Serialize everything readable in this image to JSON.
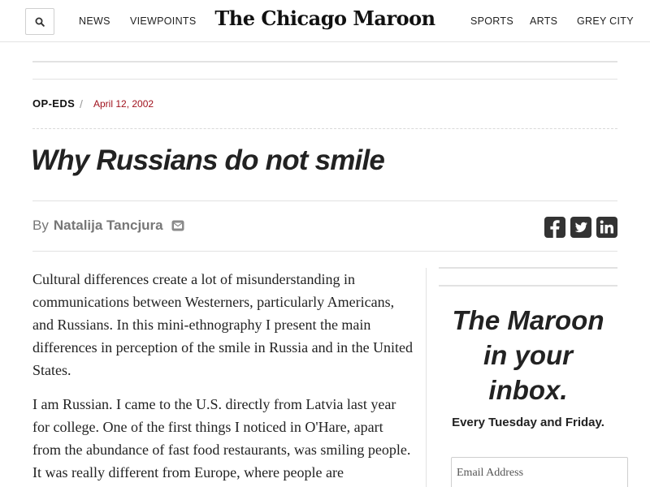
{
  "header": {
    "search_icon": "search-icon",
    "nav_left": [
      "NEWS",
      "VIEWPOINTS"
    ],
    "masthead": "The Chicago Maroon",
    "nav_right": [
      "SPORTS",
      "ARTS",
      "GREY CITY"
    ]
  },
  "article": {
    "section": "OP-EDS",
    "separator": "/",
    "date": "April 12, 2002",
    "headline": "Why Russians do not smile",
    "byline_prefix": "By",
    "author": "Natalija Tancjura",
    "paragraphs": [
      "Cultural differences create a lot of misunderstanding in communications between Westerners, particularly Americans, and Russians. In this mini-ethnography I present the main differences in perception of the smile in Russia and in the United States.",
      "I am Russian. I came to the U.S. directly from Latvia last year for college. One of the first things I noticed in O'Hare, apart from the abundance of fast food restaurants, was smiling people. It was really different from Europe, where people are"
    ]
  },
  "share": {
    "icons": [
      "facebook-icon",
      "twitter-icon",
      "linkedin-icon"
    ]
  },
  "sidebar": {
    "newsletter_title_lines": [
      "The Maroon",
      "in your",
      "inbox."
    ],
    "newsletter_subtitle": "Every Tuesday and Friday.",
    "email_placeholder": "Email Address"
  },
  "colors": {
    "date_red": "#a0121d",
    "share_icon": "#333333",
    "rule": "#e2e2e2"
  }
}
